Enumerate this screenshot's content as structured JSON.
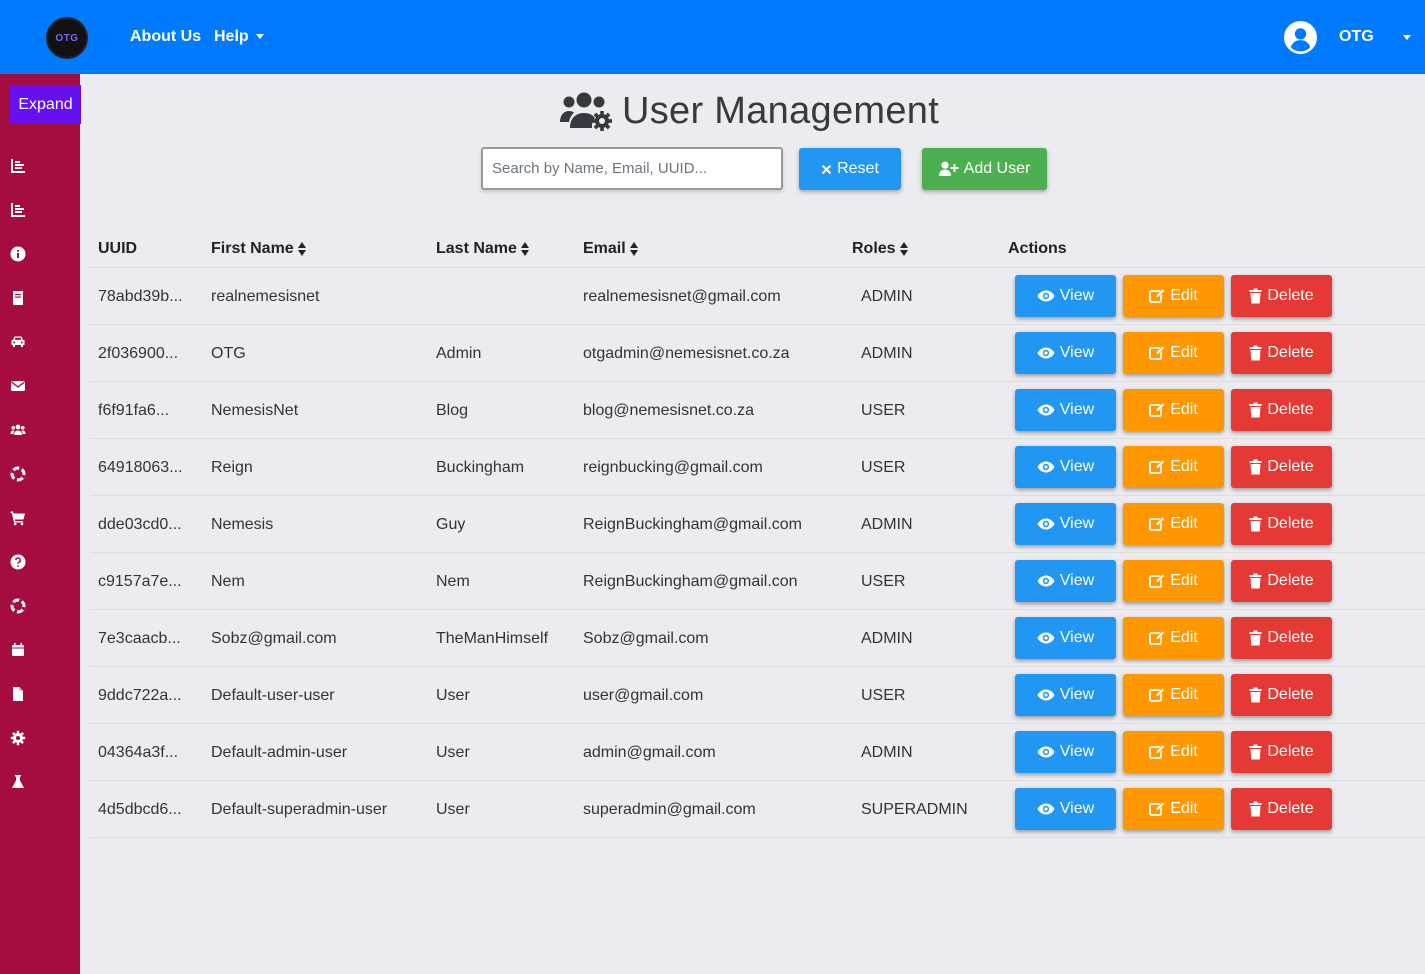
{
  "navbar": {
    "logo_text": "OTG",
    "links": [
      {
        "label": "About Us"
      },
      {
        "label": "Help"
      }
    ],
    "user_name": "OTG"
  },
  "sidebar": {
    "expand_label": "Expand",
    "icons": [
      "chart-bar-icon",
      "chart-bar-icon",
      "info-circle-icon",
      "book-icon",
      "car-icon",
      "envelope-icon",
      "users-icon",
      "life-ring-icon",
      "shopping-cart-icon",
      "question-circle-icon",
      "life-ring-icon",
      "calendar-icon",
      "file-icon",
      "cog-icon",
      "flask-icon"
    ]
  },
  "page": {
    "title": "User Management",
    "search_placeholder": "Search by Name, Email, UUID...",
    "reset_label": "Reset",
    "add_user_label": "Add User"
  },
  "table": {
    "headers": {
      "uuid": "UUID",
      "first_name": "First Name",
      "last_name": "Last Name",
      "email": "Email",
      "roles": "Roles",
      "actions": "Actions"
    },
    "action_labels": {
      "view": "View",
      "edit": "Edit",
      "delete": "Delete"
    },
    "rows": [
      {
        "uuid": "78abd39b...",
        "first": "realnemesisnet",
        "last": "",
        "email": "realnemesisnet@gmail.com",
        "role": "ADMIN"
      },
      {
        "uuid": "2f036900...",
        "first": "OTG",
        "last": "Admin",
        "email": "otgadmin@nemesisnet.co.za",
        "role": "ADMIN"
      },
      {
        "uuid": "f6f91fa6...",
        "first": "NemesisNet",
        "last": "Blog",
        "email": "blog@nemesisnet.co.za",
        "role": "USER"
      },
      {
        "uuid": "64918063...",
        "first": "Reign",
        "last": "Buckingham",
        "email": "reignbucking@gmail.com",
        "role": "USER"
      },
      {
        "uuid": "dde03cd0...",
        "first": "Nemesis",
        "last": "Guy",
        "email": "ReignBuckingham@gmail.com",
        "role": "ADMIN"
      },
      {
        "uuid": "c9157a7e...",
        "first": "Nem",
        "last": "Nem",
        "email": "ReignBuckingham@gmail.con",
        "role": "USER"
      },
      {
        "uuid": "7e3caacb...",
        "first": "Sobz@gmail.com",
        "last": "TheManHimself",
        "email": "Sobz@gmail.com",
        "role": "ADMIN"
      },
      {
        "uuid": "9ddc722a...",
        "first": "Default-user-user",
        "last": "User",
        "email": "user@gmail.com",
        "role": "USER"
      },
      {
        "uuid": "04364a3f...",
        "first": "Default-admin-user",
        "last": "User",
        "email": "admin@gmail.com",
        "role": "ADMIN"
      },
      {
        "uuid": "4d5dbcd6...",
        "first": "Default-superadmin-user",
        "last": "User",
        "email": "superadmin@gmail.com",
        "role": "SUPERADMIN"
      }
    ]
  },
  "colors": {
    "navbar": "#007bff",
    "sidebar": "#a50c40",
    "expand": "#6610f2",
    "view": "#2196f3",
    "edit": "#ff9800",
    "delete": "#e53935",
    "add": "#4caf50"
  }
}
